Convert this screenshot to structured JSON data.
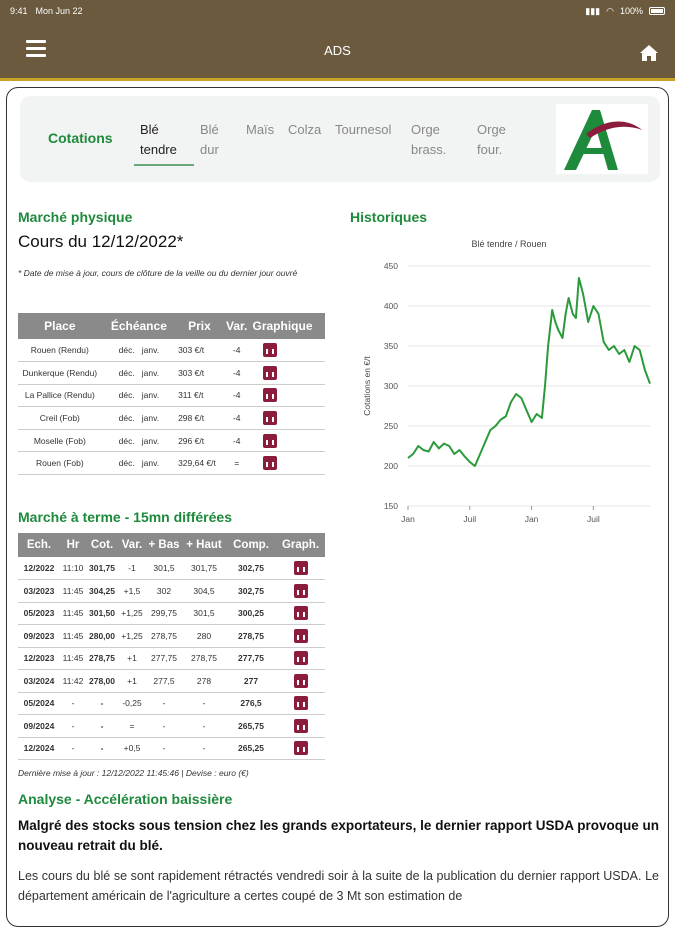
{
  "status_bar": {
    "time": "9:41",
    "date": "Mon Jun 22",
    "battery": "100%"
  },
  "nav": {
    "title": "ADS"
  },
  "tabs": {
    "section_label": "Cotations",
    "items": [
      {
        "line1": "Blé",
        "line2": "tendre"
      },
      {
        "line1": "Blé",
        "line2": "dur"
      },
      {
        "line1": "Maïs",
        "line2": ""
      },
      {
        "line1": "Colza",
        "line2": ""
      },
      {
        "line1": "Tournesol",
        "line2": ""
      },
      {
        "line1": "Orge",
        "line2": "brass."
      },
      {
        "line1": "Orge",
        "line2": "four."
      }
    ]
  },
  "physique": {
    "title": "Marché physique",
    "date": "Cours du 12/12/2022*",
    "note": "* Date de mise à jour, cours de clôture de la veille ou du dernier jour ouvré",
    "headers": [
      "Place",
      "Échéance",
      "Prix",
      "Var.",
      "Graphique"
    ],
    "rows": [
      {
        "place": "Rouen (Rendu)",
        "ech1": "déc.",
        "ech2": "janv.",
        "prix": "303 €/t",
        "var": "-4"
      },
      {
        "place": "Dunkerque (Rendu)",
        "ech1": "déc.",
        "ech2": "janv.",
        "prix": "303 €/t",
        "var": "-4"
      },
      {
        "place": "La Pallice (Rendu)",
        "ech1": "déc.",
        "ech2": "janv.",
        "prix": "311 €/t",
        "var": "-4"
      },
      {
        "place": "Creil (Fob)",
        "ech1": "déc.",
        "ech2": "janv.",
        "prix": "298 €/t",
        "var": "-4"
      },
      {
        "place": "Moselle (Fob)",
        "ech1": "déc.",
        "ech2": "janv.",
        "prix": "296 €/t",
        "var": "-4"
      },
      {
        "place": "Rouen (Fob)",
        "ech1": "déc.",
        "ech2": "janv.",
        "prix": "329,64 €/t",
        "var": "="
      }
    ]
  },
  "historiques": {
    "title": "Historiques",
    "chart_data": {
      "type": "line",
      "title": "Blé tendre / Rouen",
      "ylabel": "Cotations en €/t",
      "xlabel": "",
      "ylim": [
        150,
        450
      ],
      "yticks": [
        150,
        200,
        250,
        300,
        350,
        400,
        450
      ],
      "xtick_labels": [
        "Jan",
        "Juil",
        "Jan",
        "Juil"
      ],
      "xtick_positions": [
        0,
        6,
        12,
        18
      ],
      "xlim": [
        0,
        23.5
      ],
      "grid": true,
      "color": "#2a9a3a",
      "x": [
        0,
        0.5,
        1,
        1.5,
        2,
        2.5,
        3,
        3.5,
        4,
        4.5,
        5,
        5.5,
        6,
        6.5,
        7,
        7.5,
        8,
        8.5,
        9,
        9.5,
        10,
        10.5,
        11,
        11.5,
        12,
        12.5,
        13,
        13.3,
        13.6,
        14,
        14.3,
        14.6,
        15,
        15.3,
        15.6,
        16,
        16.3,
        16.6,
        17,
        17.5,
        18,
        18.5,
        19,
        19.5,
        20,
        20.5,
        21,
        21.5,
        22,
        22.5,
        23,
        23.5
      ],
      "y": [
        210,
        215,
        225,
        220,
        218,
        230,
        222,
        228,
        225,
        215,
        220,
        212,
        205,
        200,
        215,
        230,
        245,
        250,
        258,
        262,
        280,
        290,
        285,
        270,
        255,
        265,
        260,
        300,
        350,
        395,
        380,
        370,
        360,
        390,
        410,
        390,
        385,
        435,
        415,
        380,
        400,
        390,
        355,
        345,
        350,
        340,
        345,
        330,
        350,
        345,
        320,
        303
      ]
    }
  },
  "terme": {
    "title": "Marché à terme - 15mn différées",
    "headers": [
      "Ech.",
      "Hr",
      "Cot.",
      "Var.",
      "+ Bas",
      "+ Haut",
      "Comp.",
      "Graph."
    ],
    "rows": [
      {
        "ech": "12/2022",
        "hr": "11:10",
        "cot": "301,75",
        "var": "-1",
        "bas": "301,5",
        "haut": "301,75",
        "comp": "302,75"
      },
      {
        "ech": "03/2023",
        "hr": "11:45",
        "cot": "304,25",
        "var": "+1,5",
        "bas": "302",
        "haut": "304,5",
        "comp": "302,75"
      },
      {
        "ech": "05/2023",
        "hr": "11:45",
        "cot": "301,50",
        "var": "+1,25",
        "bas": "299,75",
        "haut": "301,5",
        "comp": "300,25"
      },
      {
        "ech": "09/2023",
        "hr": "11:45",
        "cot": "280,00",
        "var": "+1,25",
        "bas": "278,75",
        "haut": "280",
        "comp": "278,75"
      },
      {
        "ech": "12/2023",
        "hr": "11:45",
        "cot": "278,75",
        "var": "+1",
        "bas": "277,75",
        "haut": "278,75",
        "comp": "277,75"
      },
      {
        "ech": "03/2024",
        "hr": "11:42",
        "cot": "278,00",
        "var": "+1",
        "bas": "277,5",
        "haut": "278",
        "comp": "277"
      },
      {
        "ech": "05/2024",
        "hr": "-",
        "cot": "-",
        "var": "-0,25",
        "bas": "-",
        "haut": "-",
        "comp": "276,5"
      },
      {
        "ech": "09/2024",
        "hr": "-",
        "cot": "-",
        "var": "=",
        "bas": "-",
        "haut": "-",
        "comp": "265,75"
      },
      {
        "ech": "12/2024",
        "hr": "-",
        "cot": "-",
        "var": "+0,5",
        "bas": "-",
        "haut": "-",
        "comp": "265,25"
      }
    ],
    "footnote": "Dernière mise à jour : 12/12/2022 11:45:46 | Devise : euro (€)"
  },
  "analyse": {
    "title": "Analyse - Accélération baissière",
    "lead": "Malgré des stocks sous tension chez les grands exportateurs, le dernier rapport USDA provoque un nouveau retrait du blé.",
    "body": "Les cours du blé se sont rapidement rétractés vendredi soir à la suite de la publication du dernier rapport USDA. Le département américain de l'agriculture a certes coupé de 3 Mt son estimation de"
  },
  "colors": {
    "header": "#6b5a3e",
    "accent": "#1e8a3c",
    "graph_icon": "#8c1c3c",
    "table_header": "#8a8a8a"
  }
}
